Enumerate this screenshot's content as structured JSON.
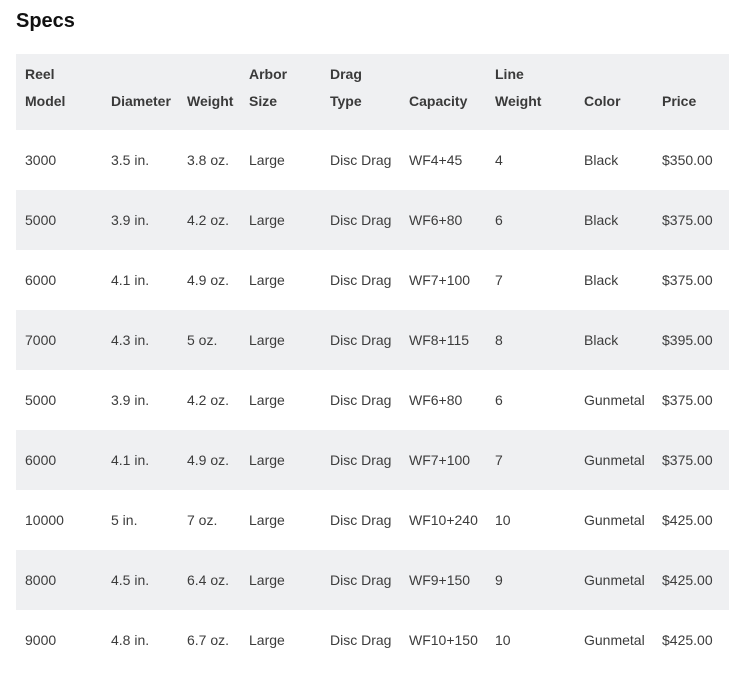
{
  "page": {
    "title": "Specs"
  },
  "table": {
    "headers": [
      "Reel\nModel",
      "Diameter",
      "Weight",
      "Arbor\nSize",
      "Drag\nType",
      "Capacity",
      "Line\nWeight",
      "Color",
      "Price"
    ],
    "rows": [
      [
        "3000",
        "3.5 in.",
        "3.8 oz.",
        "Large",
        "Disc Drag",
        "WF4+45",
        "4",
        "Black",
        "$350.00"
      ],
      [
        "5000",
        "3.9 in.",
        "4.2 oz.",
        "Large",
        "Disc Drag",
        "WF6+80",
        "6",
        "Black",
        "$375.00"
      ],
      [
        "6000",
        "4.1 in.",
        "4.9 oz.",
        "Large",
        "Disc Drag",
        "WF7+100",
        "7",
        "Black",
        "$375.00"
      ],
      [
        "7000",
        "4.3 in.",
        "5 oz.",
        "Large",
        "Disc Drag",
        "WF8+115",
        "8",
        "Black",
        "$395.00"
      ],
      [
        "5000",
        "3.9 in.",
        "4.2 oz.",
        "Large",
        "Disc Drag",
        "WF6+80",
        "6",
        "Gunmetal",
        "$375.00"
      ],
      [
        "6000",
        "4.1 in.",
        "4.9 oz.",
        "Large",
        "Disc Drag",
        "WF7+100",
        "7",
        "Gunmetal",
        "$375.00"
      ],
      [
        "10000",
        "5 in.",
        "7 oz.",
        "Large",
        "Disc Drag",
        "WF10+240",
        "10",
        "Gunmetal",
        "$425.00"
      ],
      [
        "8000",
        "4.5 in.",
        "6.4 oz.",
        "Large",
        "Disc Drag",
        "WF9+150",
        "9",
        "Gunmetal",
        "$425.00"
      ],
      [
        "9000",
        "4.8 in.",
        "6.7 oz.",
        "Large",
        "Disc Drag",
        "WF10+150",
        "10",
        "Gunmetal",
        "$425.00"
      ]
    ]
  },
  "colors": {
    "header_background": "#eff0f2",
    "stripe_background": "#eff0f2",
    "text": "#3c3c3c"
  }
}
